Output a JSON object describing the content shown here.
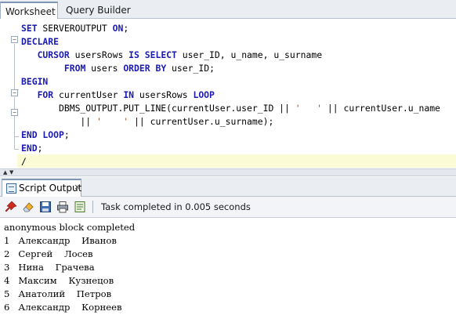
{
  "tabs": {
    "worksheet": "Worksheet",
    "query_builder": "Query Builder"
  },
  "editor": {
    "lines": [
      [
        [
          "k",
          "SET"
        ],
        [
          "t",
          " SERVEROUTPUT "
        ],
        [
          "k",
          "ON"
        ],
        [
          "t",
          ";"
        ]
      ],
      [
        [
          "k",
          "DECLARE"
        ]
      ],
      [
        [
          "t",
          "   "
        ],
        [
          "k",
          "CURSOR"
        ],
        [
          "t",
          " usersRows "
        ],
        [
          "k",
          "IS SELECT"
        ],
        [
          "t",
          " user_ID, u_name, u_surname"
        ]
      ],
      [
        [
          "t",
          "        "
        ],
        [
          "k",
          "FROM"
        ],
        [
          "t",
          " users "
        ],
        [
          "k",
          "ORDER BY"
        ],
        [
          "t",
          " user_ID;"
        ]
      ],
      [
        [
          "k",
          "BEGIN"
        ]
      ],
      [
        [
          "t",
          "   "
        ],
        [
          "k",
          "FOR"
        ],
        [
          "t",
          " currentUser "
        ],
        [
          "k",
          "IN"
        ],
        [
          "t",
          " usersRows "
        ],
        [
          "k",
          "LOOP"
        ]
      ],
      [
        [
          "t",
          "       DBMS_OUTPUT.PUT_LINE(currentUser.user_ID || "
        ],
        [
          "s",
          "'   '"
        ],
        [
          "t",
          " || currentUser.u_name"
        ]
      ],
      [
        [
          "t",
          "           || "
        ],
        [
          "s",
          "'    '"
        ],
        [
          "t",
          " || currentUser.u_surname);"
        ]
      ],
      [
        [
          "k",
          "END LOOP"
        ],
        [
          "t",
          ";"
        ]
      ],
      [
        [
          "k",
          "END"
        ],
        [
          "t",
          ";"
        ]
      ],
      [
        [
          "t",
          "/"
        ]
      ]
    ]
  },
  "output_panel": {
    "tab_label": "Script Output",
    "close": "×",
    "status": "Task completed in 0.005 seconds",
    "toolbar_icons": [
      "pin-icon",
      "eraser-icon",
      "save-icon",
      "print-icon",
      "export-icon"
    ],
    "lines": [
      "anonymous block completed",
      "1   Александр    Иванов",
      "2   Сергей    Лосев",
      "3   Нина    Грачева",
      "4   Максим    Кузнецов",
      "5   Анатолий    Петров",
      "6   Александр    Корнеев"
    ]
  },
  "colors": {
    "keyword": "#1a1ab5",
    "string": "#a0522d",
    "current_line": "#fbfbd6"
  }
}
